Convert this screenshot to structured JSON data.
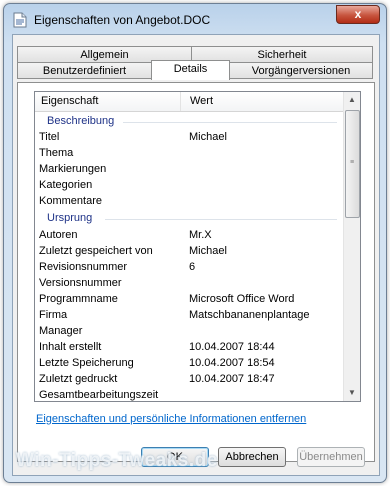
{
  "window": {
    "title": "Eigenschaften von Angebot.DOC",
    "close_label": "x"
  },
  "tabs": {
    "row1": [
      "Allgemein",
      "Sicherheit"
    ],
    "row2": [
      "Benutzerdefiniert",
      "Details",
      "Vorgängerversionen"
    ]
  },
  "list": {
    "columns": [
      "Eigenschaft",
      "Wert"
    ],
    "groups": {
      "beschreibung": "Beschreibung",
      "ursprung": "Ursprung"
    },
    "rows": [
      {
        "k": "Titel",
        "v": "Michael"
      },
      {
        "k": "Thema",
        "v": ""
      },
      {
        "k": "Markierungen",
        "v": ""
      },
      {
        "k": "Kategorien",
        "v": ""
      },
      {
        "k": "Kommentare",
        "v": ""
      },
      {
        "k": "Autoren",
        "v": "Mr.X"
      },
      {
        "k": "Zuletzt gespeichert von",
        "v": "Michael"
      },
      {
        "k": "Revisionsnummer",
        "v": "6"
      },
      {
        "k": "Versionsnummer",
        "v": ""
      },
      {
        "k": "Programmname",
        "v": "Microsoft Office Word"
      },
      {
        "k": "Firma",
        "v": "Matschbananenplantage"
      },
      {
        "k": "Manager",
        "v": ""
      },
      {
        "k": "Inhalt erstellt",
        "v": "10.04.2007 18:44"
      },
      {
        "k": "Letzte Speicherung",
        "v": "10.04.2007 18:54"
      },
      {
        "k": "Zuletzt gedruckt",
        "v": "10.04.2007 18:47"
      },
      {
        "k": "Gesamtbearbeitungszeit",
        "v": ""
      }
    ]
  },
  "link": "Eigenschaften und persönliche Informationen entfernen",
  "buttons": {
    "ok": "OK",
    "cancel": "Abbrechen",
    "apply": "Übernehmen"
  },
  "watermark": "Win-Tipps-Tweaks.de"
}
